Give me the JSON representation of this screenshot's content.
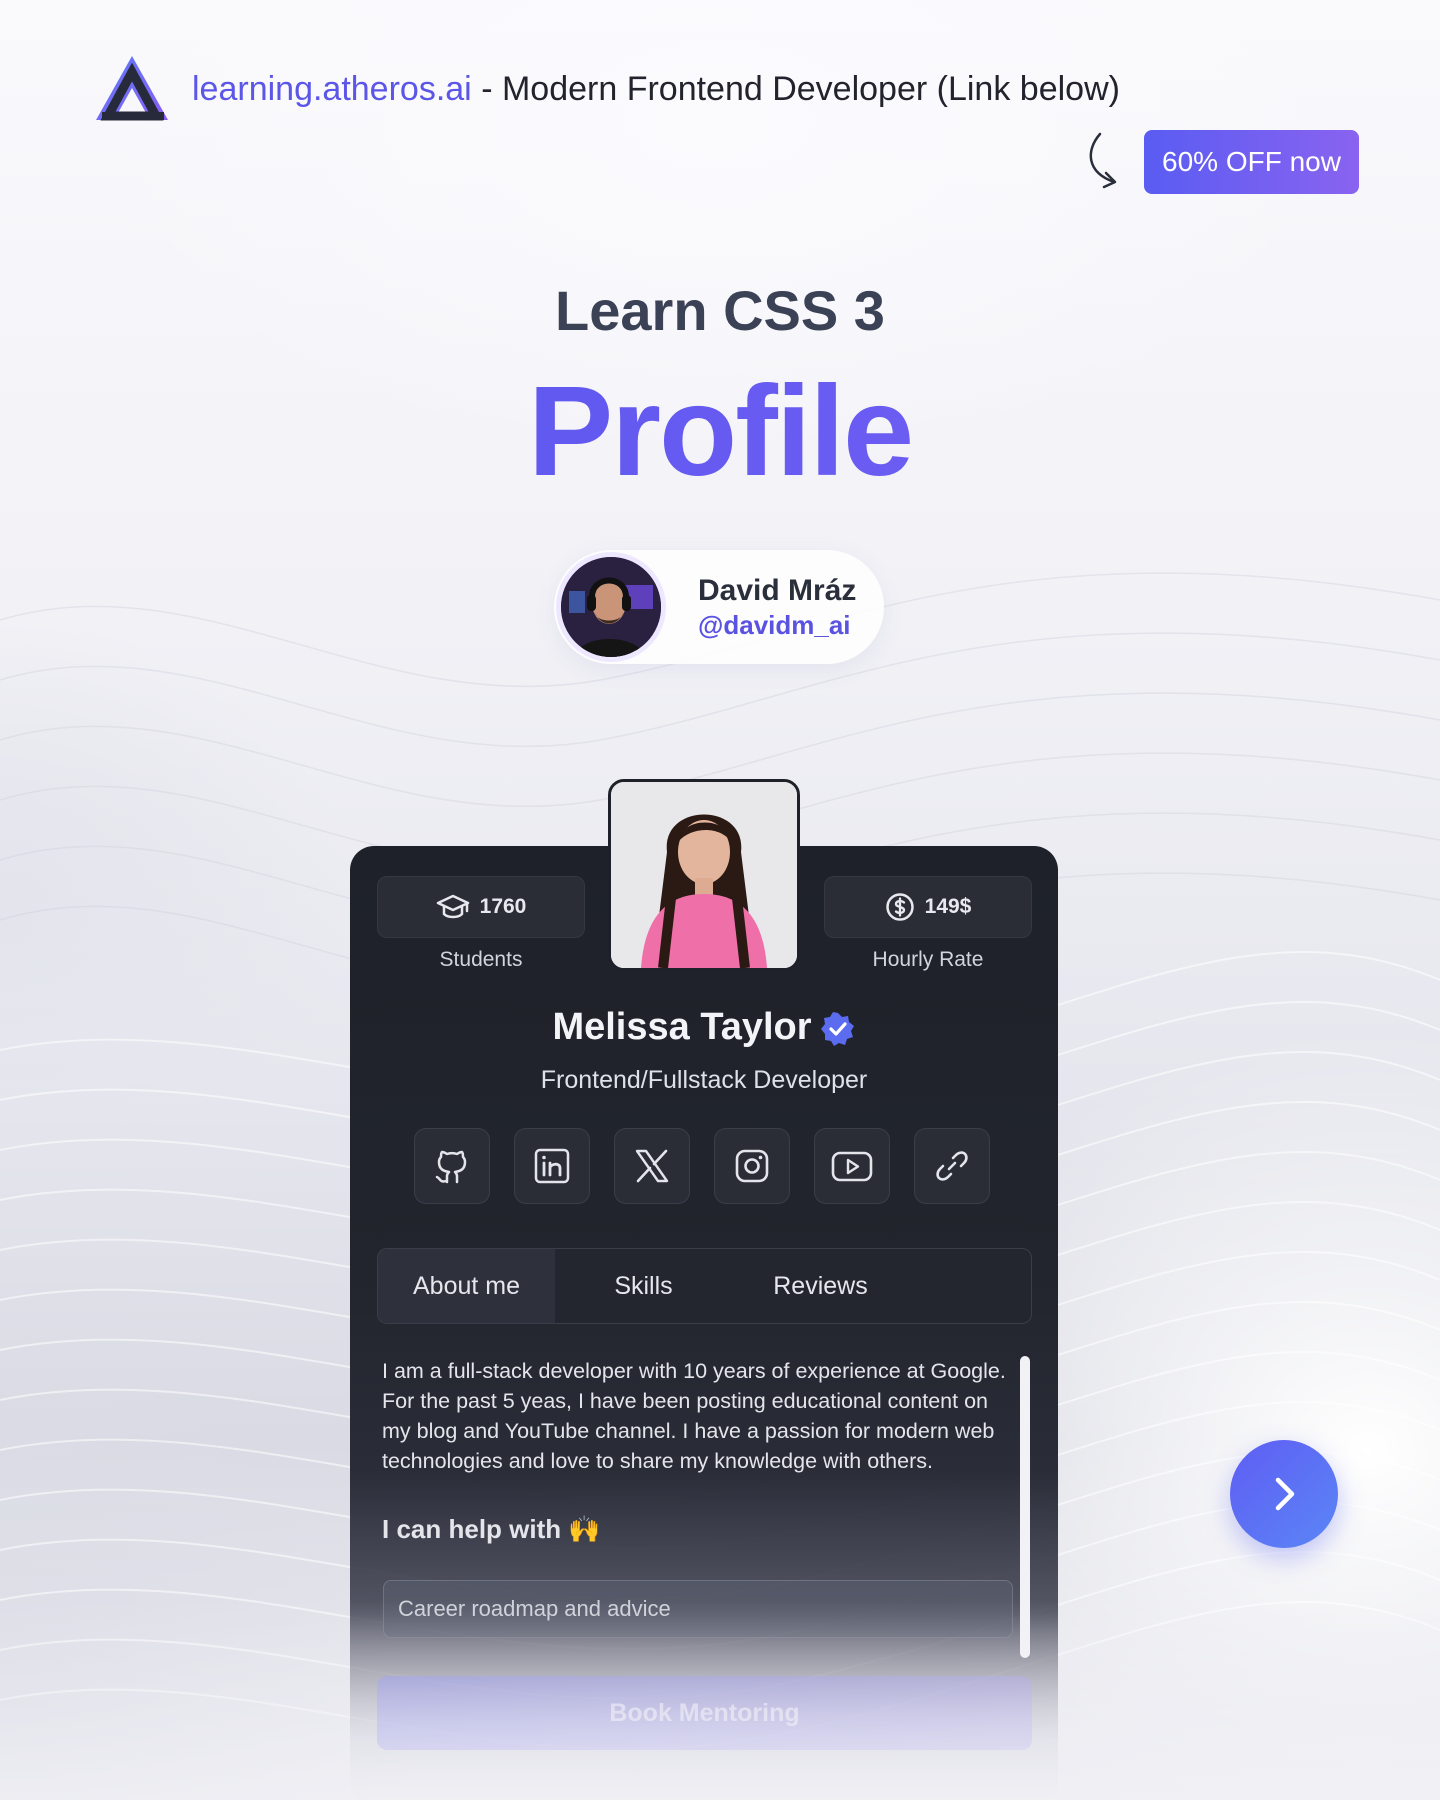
{
  "header": {
    "link_text": "learning.atheros.ai",
    "rest_text": " - Modern Frontend Developer (Link below)",
    "offer_button": "60% OFF now"
  },
  "hero": {
    "subtitle": "Learn CSS 3",
    "title": "Profile"
  },
  "author": {
    "name": "David Mráz",
    "handle": "@davidm_ai"
  },
  "card": {
    "students_value": "1760",
    "students_label": "Students",
    "rate_value": "149$",
    "rate_label": "Hourly Rate",
    "name": "Melissa Taylor",
    "role": "Frontend/Fullstack Developer",
    "socials": [
      "github-icon",
      "linkedin-icon",
      "x-icon",
      "instagram-icon",
      "youtube-icon",
      "link-icon"
    ],
    "tabs": [
      {
        "label": "About me",
        "active": true
      },
      {
        "label": "Skills",
        "active": false
      },
      {
        "label": "Reviews",
        "active": false
      }
    ],
    "about": "I am a full-stack developer with 10 years of experience at Google. For the past 5 yeas, I have been posting educational content on my blog and YouTube channel. I have a passion for modern web technologies and love to share my knowledge with others.",
    "help_heading": "I can help with",
    "help_emoji": "🙌",
    "help_input_value": "Career roadmap and advice",
    "book_button": "Book Mentoring"
  },
  "colors": {
    "accent": "#5b57ea",
    "card_bg": "#1e2129",
    "verified": "#5b6cf0"
  }
}
